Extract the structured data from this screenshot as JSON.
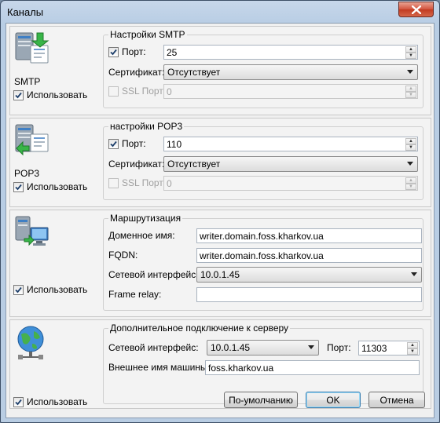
{
  "window": {
    "title": "Каналы",
    "close_label": "✕"
  },
  "smtp": {
    "group_title": "Настройки SMTP",
    "protocol_label": "SMTP",
    "use_label": "Использовать",
    "use_checked": true,
    "port_label": "Порт:",
    "port_checked": true,
    "port_value": "25",
    "cert_label": "Сертификат:",
    "cert_value": "Отсутствует",
    "ssl_label": "SSL Порт:",
    "ssl_checked": false,
    "ssl_value": "0"
  },
  "pop3": {
    "group_title": "настройки POP3",
    "protocol_label": "POP3",
    "use_label": "Использовать",
    "use_checked": true,
    "port_label": "Порт:",
    "port_checked": true,
    "port_value": "110",
    "cert_label": "Сертификат:",
    "cert_value": "Отсутствует",
    "ssl_label": "SSL Порт:",
    "ssl_checked": false,
    "ssl_value": "0"
  },
  "routing": {
    "group_title": "Маршрутизация",
    "use_label": "Использовать",
    "use_checked": true,
    "domain_label": "Доменное имя:",
    "domain_value": "writer.domain.foss.kharkov.ua",
    "fqdn_label": "FQDN:",
    "fqdn_value": "writer.domain.foss.kharkov.ua",
    "iface_label": "Сетевой интерфейс:",
    "iface_value": "10.0.1.45",
    "relay_label": "Frame relay:",
    "relay_value": ""
  },
  "extra": {
    "group_title": "Дополнительное подключение к серверу",
    "use_label": "Использовать",
    "use_checked": true,
    "iface_label": "Сетевой интерфейс:",
    "iface_value": "10.0.1.45",
    "port_label": "Порт:",
    "port_value": "11303",
    "extname_label": "Внешнее имя машины:",
    "extname_value": "foss.kharkov.ua"
  },
  "buttons": {
    "default_label": "По-умолчанию",
    "ok_label": "OK",
    "cancel_label": "Отмена"
  }
}
